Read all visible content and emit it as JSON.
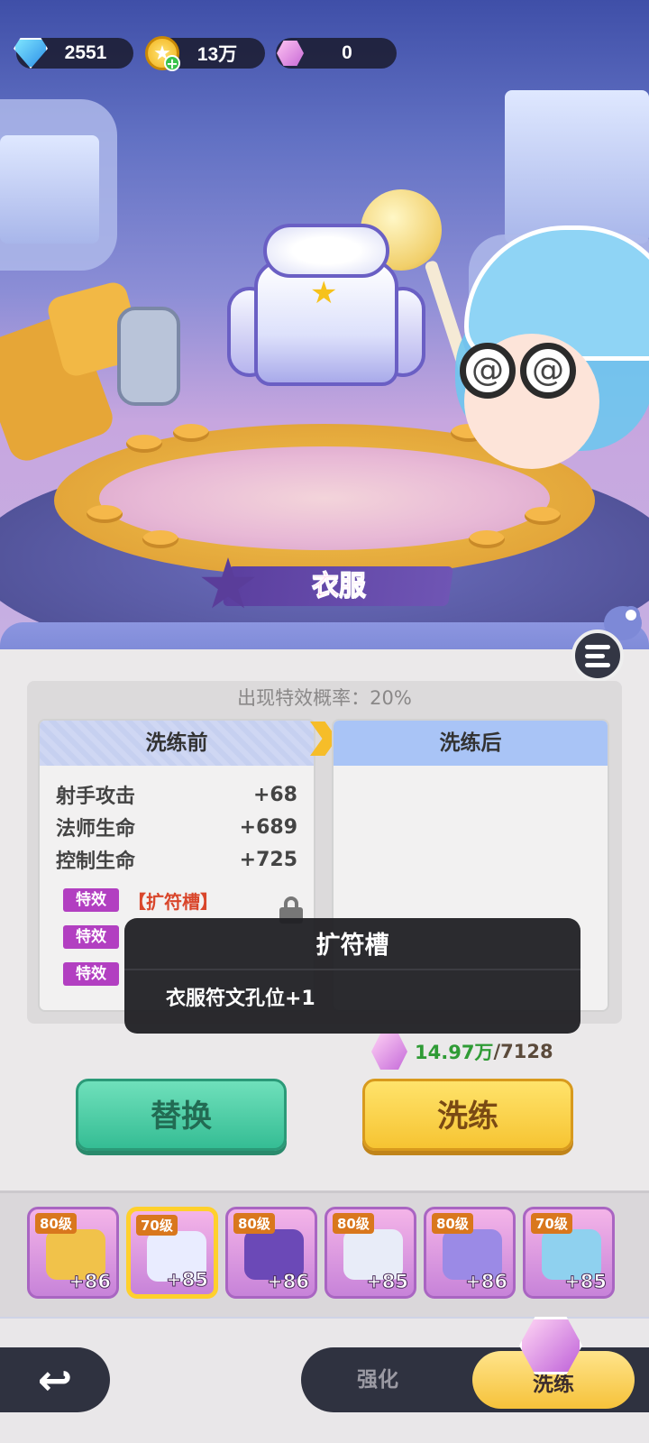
{
  "currencies": [
    {
      "name": "diamond",
      "value": "2551",
      "icon": "diamond-icon"
    },
    {
      "name": "gold",
      "value": "13万",
      "icon": "gold-coin-icon"
    },
    {
      "name": "refine-stone",
      "value": "0",
      "icon": "pink-gem-icon"
    }
  ],
  "item_title": "衣服",
  "panel": {
    "rate_label": "出现特效概率：20%",
    "before": {
      "title": "洗练前",
      "stats": [
        {
          "name": "射手攻击",
          "value": "+68"
        },
        {
          "name": "法师生命",
          "value": "+689"
        },
        {
          "name": "控制生命",
          "value": "+725"
        }
      ],
      "effects": [
        {
          "tag": "特效",
          "name": "【扩符槽】"
        },
        {
          "tag": "特效",
          "name": ""
        },
        {
          "tag": "特效",
          "name": ""
        }
      ]
    },
    "after": {
      "title": "洗练后"
    }
  },
  "tooltip": {
    "title": "扩符槽",
    "desc": "衣服符文孔位+1"
  },
  "cost": {
    "have": "14.97万",
    "need": "/7128"
  },
  "buttons": {
    "replace": "替换",
    "refine": "洗练"
  },
  "equipment": [
    {
      "level": "80级",
      "plus": "+86",
      "icon": "helmet-icon",
      "color": "#f1c24a"
    },
    {
      "level": "70级",
      "plus": "+85",
      "icon": "jacket-icon",
      "color": "#e9ecff",
      "selected": true
    },
    {
      "level": "80级",
      "plus": "+86",
      "icon": "bracer-icon",
      "color": "#6b49b7"
    },
    {
      "level": "80级",
      "plus": "+85",
      "icon": "pants-icon",
      "color": "#e8ecf8"
    },
    {
      "level": "80级",
      "plus": "+86",
      "icon": "boots-icon",
      "color": "#9b8ae6"
    },
    {
      "level": "70级",
      "plus": "+85",
      "icon": "orb-icon",
      "color": "#8fd1ef"
    }
  ],
  "tabs": {
    "strengthen": "强化",
    "refine": "洗练"
  },
  "colors": {
    "accent_yellow": "#f6c432",
    "accent_green": "#35bd94",
    "effect_purple": "#b23fc1"
  }
}
